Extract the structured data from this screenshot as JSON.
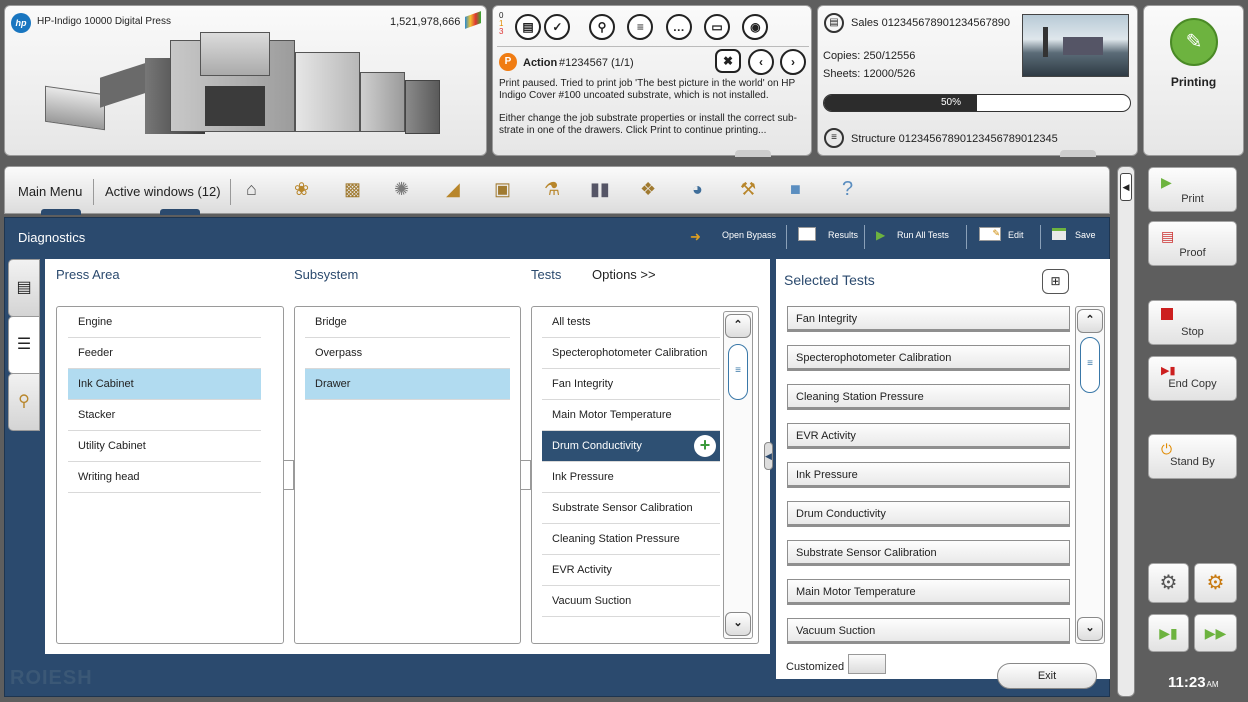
{
  "printer": {
    "model": "HP-Indigo 10000 Digital Press",
    "counter": "1,521,978,666",
    "logo": "hp"
  },
  "alerts": {
    "counts": [
      "0",
      "1",
      "3"
    ]
  },
  "action": {
    "label": "Action",
    "job": "#1234567 (1/1)",
    "message1": "Print paused. Tried to print job 'The best picture in the world' on HP Indigo Cover #100 uncoated substrate, which is not installed.",
    "message2": "Either change the job substrate properties or install the correct sub-strate in one of the drawers. Click Print to continue printing..."
  },
  "job": {
    "sales": "Sales 01234567890123456789­0",
    "copies": "Copies: 250/12556",
    "sheets": "Sheets: 12000/526",
    "progress": 50,
    "progress_label": "50%",
    "structure": "Structure 012345678901234567890­12345"
  },
  "status": {
    "label": "Printing",
    "color": "#6db33f"
  },
  "nav": {
    "main_menu": "Main Menu",
    "active_windows": "Active windows (12)"
  },
  "diagnostics": {
    "title": "Diagnostics",
    "open_bypass": "Open Bypass",
    "results": "Results",
    "run_all": "Run  All Tests",
    "edit": "Edit",
    "save": "Save"
  },
  "columns": {
    "press_area": "Press Area",
    "subsystem": "Subsystem",
    "tests": "Tests",
    "options": "Options >>",
    "selected_tests": "Selected Tests"
  },
  "press_area_items": [
    {
      "label": "Engine"
    },
    {
      "label": "Feeder"
    },
    {
      "label": "Ink Cabinet"
    },
    {
      "label": "Stacker"
    },
    {
      "label": "Utility Cabinet"
    },
    {
      "label": "Writing head"
    }
  ],
  "subsystem_items": [
    {
      "label": "Bridge"
    },
    {
      "label": "Overpass"
    },
    {
      "label": "Drawer"
    }
  ],
  "tests_items": [
    {
      "label": "All tests"
    },
    {
      "label": "Specterophotometer Calibration"
    },
    {
      "label": "Fan Integrity"
    },
    {
      "label": "Main Motor Temperature"
    },
    {
      "label": "Drum Conductivity"
    },
    {
      "label": "Ink Pressure"
    },
    {
      "label": "Substrate Sensor Calibration"
    },
    {
      "label": "Cleaning Station Pressure"
    },
    {
      "label": "EVR Activity"
    },
    {
      "label": "Vacuum Suction"
    }
  ],
  "selected_tests_items": [
    {
      "label": "Fan Integrity"
    },
    {
      "label": "Specterophotometer Calibration"
    },
    {
      "label": "Cleaning Station Pressure"
    },
    {
      "label": "EVR Activity"
    },
    {
      "label": "Ink Pressure"
    },
    {
      "label": "Drum Conductivity"
    },
    {
      "label": "Substrate Sensor Calibration"
    },
    {
      "label": "Main Motor Temperature"
    },
    {
      "label": "Vacuum Suction"
    }
  ],
  "customized": "Customized",
  "exit": "Exit",
  "right_panel": {
    "print": "Print",
    "proof": "Proof",
    "stop": "Stop",
    "end_copy": "End Copy",
    "stand_by": "Stand By"
  },
  "clock": {
    "time": "11:23",
    "ampm": "AM"
  },
  "watermark": "ROIESH",
  "colors": {
    "header_blue": "#2b4a6e",
    "selected_row": "#b1dbf0",
    "active_row": "#2e5073",
    "accent_green": "#6db33f",
    "stop_red": "#cc1f1f"
  }
}
